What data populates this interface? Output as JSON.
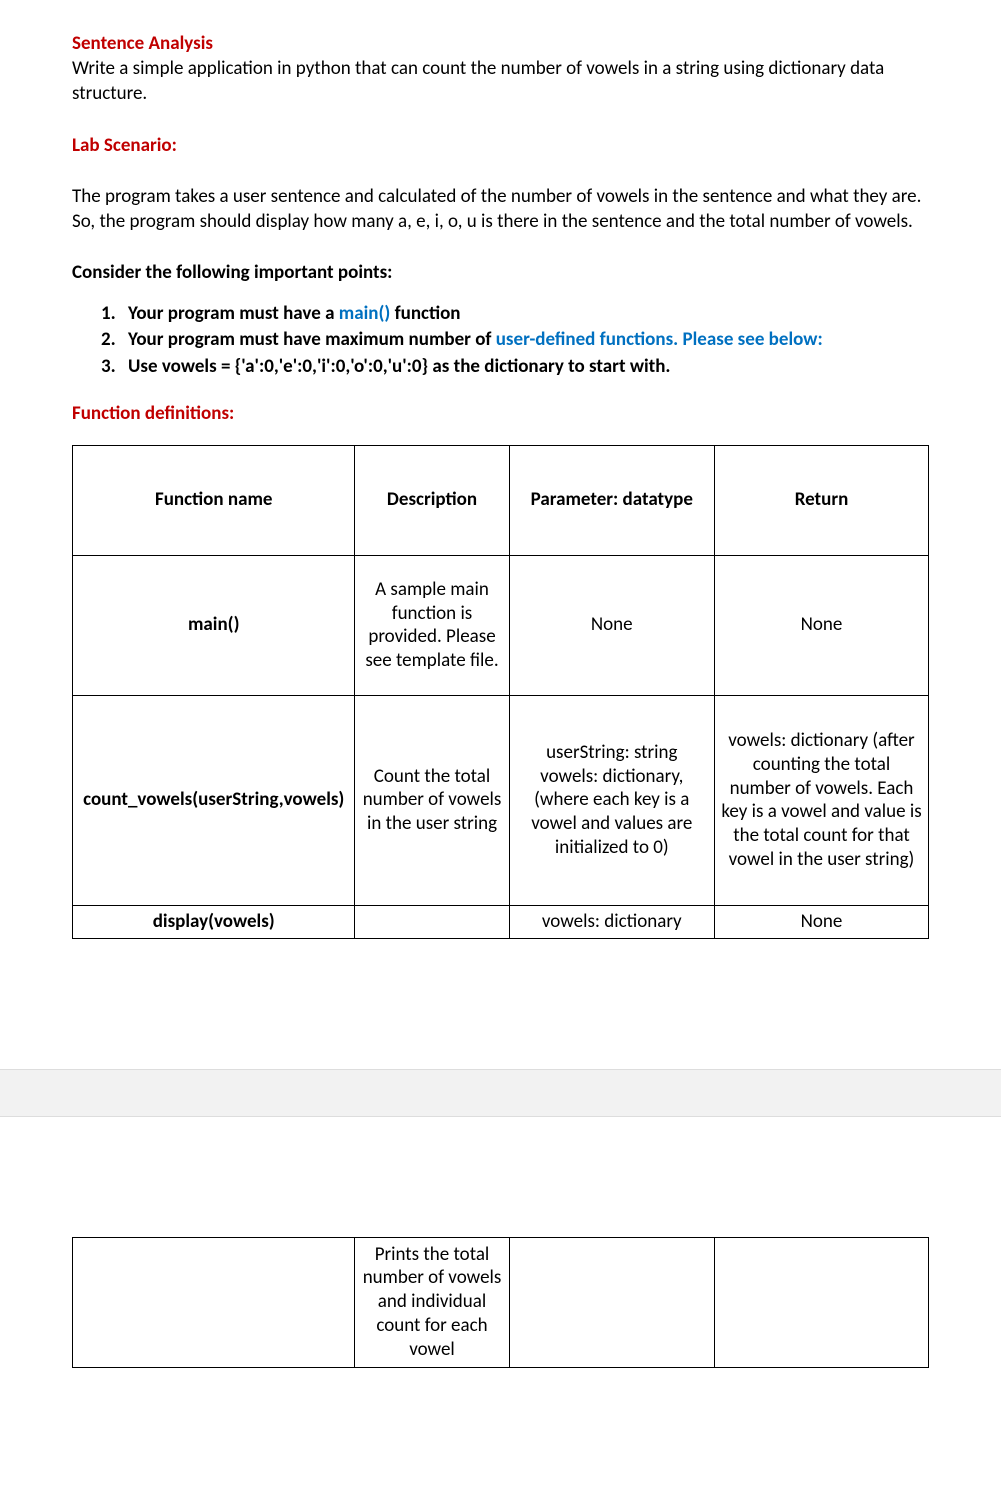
{
  "headings": {
    "title": "Sentence Analysis",
    "lab": "Lab Scenario:",
    "func_def": "Function definitions:",
    "consider": "Consider the following important points:"
  },
  "intro": "Write a simple application in python that can count the number of vowels in a string using dictionary data structure.",
  "scenario": "The program takes a user sentence and calculated of the number of vowels in the sentence and what they are. So, the program should display how many a, e, i, o, u is there in the sentence and the total number of vowels.",
  "points": {
    "p1_a": "Your program must have a ",
    "p1_b": "main()",
    "p1_c": " function",
    "p2_a": "Your program must have maximum number of ",
    "p2_b": "user-defined functions. Please see below:",
    "p3": "Use vowels = {'a':0,'e':0,'i':0,'o':0,'u':0} as the dictionary to start with."
  },
  "table_header": {
    "c1": "Function name",
    "c2": "Description",
    "c3": "Parameter: datatype",
    "c4": "Return"
  },
  "row_main": {
    "name": "main()",
    "desc": "A sample main function is provided. Please see template file.",
    "param": "None",
    "ret": "None"
  },
  "row_count": {
    "name": "count_vowels(userString,vowels)",
    "desc": "Count the total number of vowels in the user string",
    "param": "userString: string vowels: dictionary, (where each key is a vowel and values are initialized to 0)",
    "ret": "vowels: dictionary (after counting the total number of vowels. Each key is a vowel and value is the total count for that vowel in the user string)"
  },
  "row_display": {
    "name": "display(vowels)",
    "desc": "",
    "param": "vowels: dictionary",
    "ret": "None"
  },
  "row_display2": {
    "name": "",
    "desc": "Prints the total number of vowels and individual count for each vowel",
    "param": "",
    "ret": ""
  }
}
